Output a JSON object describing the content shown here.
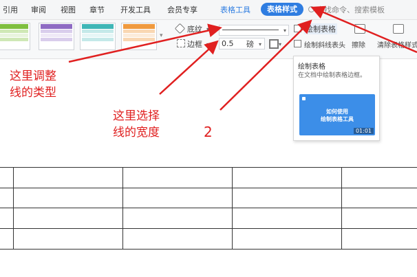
{
  "menu": {
    "items": [
      "引用",
      "审阅",
      "视图",
      "章节",
      "开发工具",
      "会员专享"
    ],
    "table_tools": "表格工具",
    "table_style": "表格样式",
    "search_placeholder": "查找命令、搜索模板"
  },
  "ribbon": {
    "shading_label": "底纹",
    "border_label": "边框",
    "line_width_value": "0.5",
    "line_width_unit": "磅",
    "draw_table_label": "绘制表格",
    "draw_diagonal_label": "绘制斜线表头",
    "erase_label": "擦除",
    "clear_style_label": "清除表格样式"
  },
  "tooltip": {
    "title": "绘制表格",
    "description": "在文档中绘制表格边框。",
    "video_caption_line1": "如何使用",
    "video_caption_line2": "绘制表格工具",
    "video_duration": "01:01"
  },
  "annotations": {
    "line_type_1": "这里调整",
    "line_type_2": "线的类型",
    "line_width_1": "这里选择",
    "line_width_2": "线的宽度",
    "number": "2"
  },
  "colors": {
    "accent": "#2f7de1",
    "annotation": "#e02020",
    "swatch_green": "#7fbf3f",
    "swatch_purple": "#8e6bc3",
    "swatch_teal": "#3fb6b6",
    "swatch_orange": "#f09a3e"
  }
}
